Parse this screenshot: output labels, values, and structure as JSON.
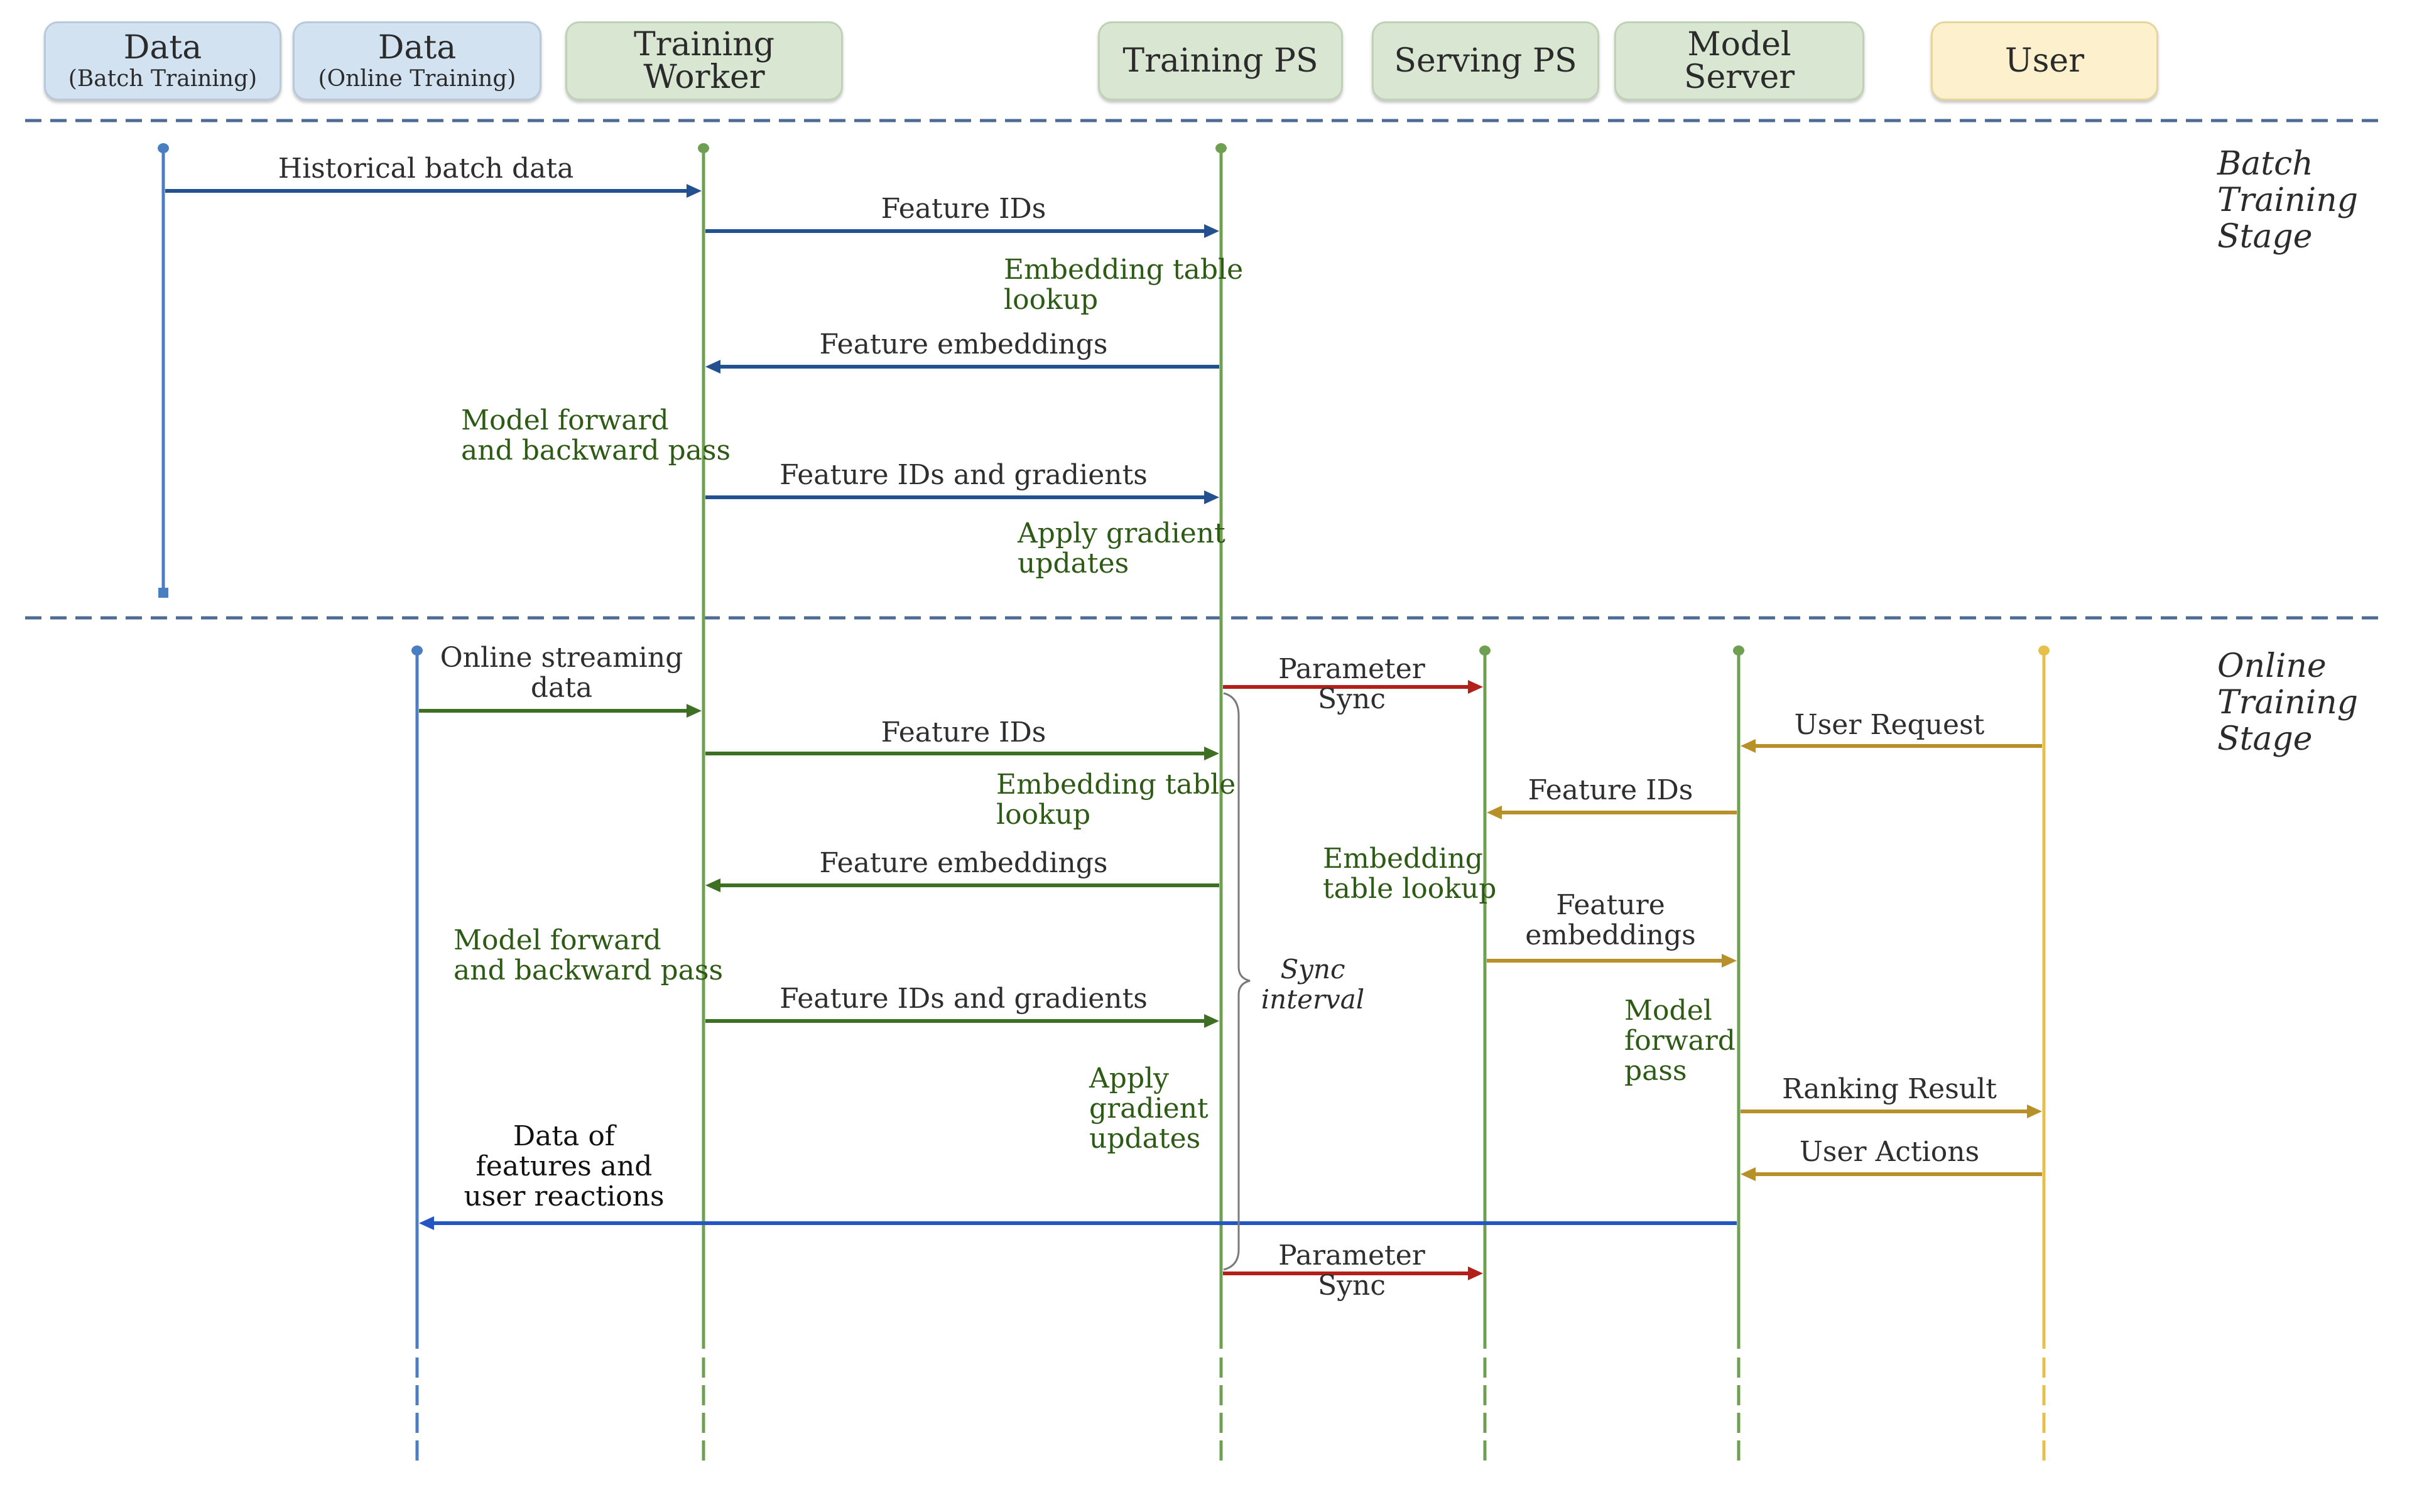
{
  "participants": [
    {
      "id": "data-batch",
      "label": "Data",
      "sublabel": "(Batch Training)",
      "kind": "data"
    },
    {
      "id": "data-online",
      "label": "Data",
      "sublabel": "(Online Training)",
      "kind": "data"
    },
    {
      "id": "training-worker",
      "label": "Training\nWorker",
      "kind": "component"
    },
    {
      "id": "training-ps",
      "label": "Training PS",
      "kind": "component"
    },
    {
      "id": "serving-ps",
      "label": "Serving PS",
      "kind": "component"
    },
    {
      "id": "model-server",
      "label": "Model\nServer",
      "kind": "component"
    },
    {
      "id": "user",
      "label": "User",
      "kind": "user"
    }
  ],
  "colors": {
    "data_blue": "#4a7ec2",
    "component_green": "#6fa052",
    "user_yellow": "#e6c04a",
    "batch_arrow": "#23508e",
    "online_arrow": "#3d7022",
    "sync_arrow": "#b3201a",
    "serving_arrow": "#b8902a",
    "feedback_arrow": "#2356c2",
    "divider": "#4e6a96",
    "brace": "#7a7a7a"
  },
  "stages": {
    "batch": "Batch\nTraining\nStage",
    "online": "Online\nTraining\nStage"
  },
  "batch_messages": [
    {
      "label": "Historical batch data",
      "from": "data-batch",
      "to": "training-worker"
    },
    {
      "label": "Feature IDs",
      "from": "training-worker",
      "to": "training-ps"
    },
    {
      "label": "Feature embeddings",
      "from": "training-ps",
      "to": "training-worker"
    },
    {
      "label": "Feature IDs and gradients",
      "from": "training-worker",
      "to": "training-ps"
    }
  ],
  "batch_actions": [
    {
      "label": "Embedding table\nlookup",
      "at": "training-ps"
    },
    {
      "label": "Model forward\nand backward pass",
      "at": "training-worker"
    },
    {
      "label": "Apply gradient\nupdates",
      "at": "training-ps"
    }
  ],
  "online_messages": [
    {
      "label": "Online streaming\ndata",
      "from": "data-online",
      "to": "training-worker"
    },
    {
      "label": "Parameter\nSync",
      "from": "training-ps",
      "to": "serving-ps"
    },
    {
      "label": "User Request",
      "from": "user",
      "to": "model-server"
    },
    {
      "label": "Feature IDs",
      "from": "training-worker",
      "to": "training-ps"
    },
    {
      "label": "Feature IDs",
      "from": "model-server",
      "to": "serving-ps"
    },
    {
      "label": "Feature embeddings",
      "from": "training-ps",
      "to": "training-worker"
    },
    {
      "label": "Feature\nembeddings",
      "from": "serving-ps",
      "to": "model-server"
    },
    {
      "label": "Feature IDs and gradients",
      "from": "training-worker",
      "to": "training-ps"
    },
    {
      "label": "Ranking Result",
      "from": "model-server",
      "to": "user"
    },
    {
      "label": "User Actions",
      "from": "user",
      "to": "model-server"
    },
    {
      "label": "Data of\nfeatures and\nuser reactions",
      "from": "model-server",
      "to": "data-online"
    },
    {
      "label": "Parameter\nSync",
      "from": "training-ps",
      "to": "serving-ps"
    }
  ],
  "online_actions": [
    {
      "label": "Embedding table\nlookup",
      "at": "training-ps"
    },
    {
      "label": "Model forward\nand backward pass",
      "at": "training-worker"
    },
    {
      "label": "Apply\ngradient\nupdates",
      "at": "training-ps"
    },
    {
      "label": "Embedding\ntable lookup",
      "at": "serving-ps"
    },
    {
      "label": "Model\nforward\npass",
      "at": "model-server"
    }
  ],
  "sync_interval": "Sync\ninterval"
}
